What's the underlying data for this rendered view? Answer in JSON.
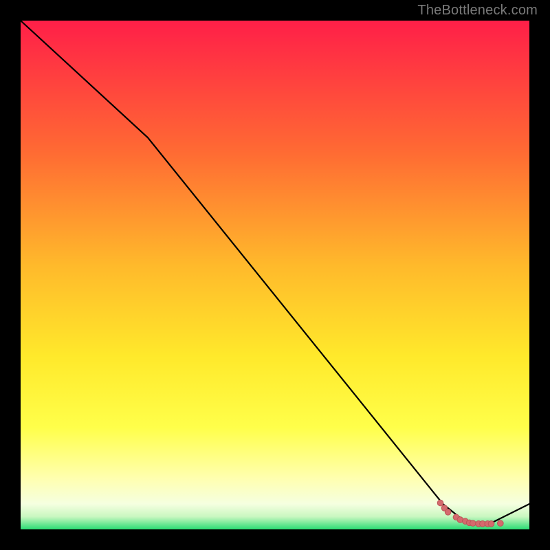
{
  "watermark_text": "TheBottleneck.com",
  "colors": {
    "bg": "#000000",
    "grad_top": "#ff1f48",
    "grad_mid_upper": "#ff8b2e",
    "grad_mid": "#ffd52a",
    "grad_lower": "#ffff33",
    "grad_pale": "#ffffc0",
    "grad_green": "#2bdc74",
    "line": "#000000",
    "marker_fill": "#d46a6d",
    "marker_stroke": "#bc5457"
  },
  "chart_data": {
    "type": "line",
    "title": "",
    "xlabel": "",
    "ylabel": "",
    "xlim": [
      0,
      100
    ],
    "ylim": [
      0,
      100
    ],
    "series": [
      {
        "name": "curve",
        "x": [
          0,
          25,
          83,
          88,
          91,
          92,
          100
        ],
        "y": [
          100,
          77,
          5,
          1,
          1,
          1,
          5
        ]
      }
    ],
    "markers": {
      "name": "points-near-minimum",
      "x": [
        82.5,
        83.3,
        84.0,
        85.6,
        86.4,
        87.4,
        88.2,
        88.9,
        90.0,
        90.8,
        91.8,
        92.5,
        94.3
      ],
      "y": [
        5.2,
        4.2,
        3.4,
        2.4,
        1.9,
        1.6,
        1.3,
        1.2,
        1.1,
        1.1,
        1.1,
        1.1,
        1.2
      ]
    },
    "notes": "Axes have no tick labels in the image; values estimated from visual position on a normalized 0–100 scale."
  }
}
